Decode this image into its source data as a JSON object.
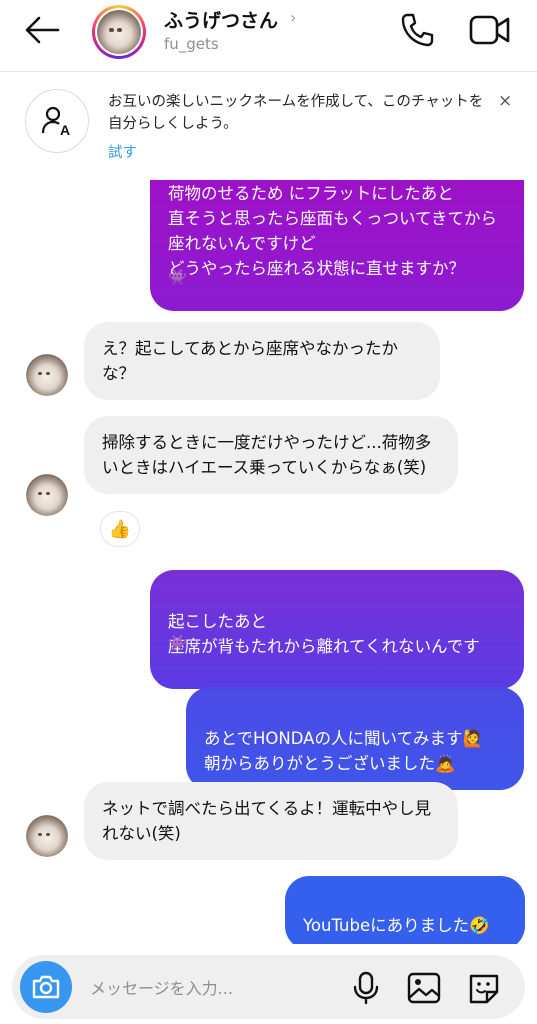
{
  "header": {
    "name": "ふうげつさん",
    "chevron": "›",
    "username": "fu_gets"
  },
  "banner": {
    "text": "お互いの楽しいニックネームを作成して、このチャットを自分らしくしよう。",
    "try_label": "試す",
    "close_label": "×"
  },
  "messages": [
    {
      "from": "me",
      "text": "荷物のせるため にフラットにしたあと\n直そうと思ったら座面もくっついてきてから座れないんですけど\nどうやったら座れる状態に直せますか？"
    },
    {
      "from": "them",
      "text": "え？起こしてあとから座席やなかったかな？"
    },
    {
      "from": "them",
      "text": "掃除するときに一度だけやったけど...荷物多いときはハイエース乗っていくからなぁ(笑)",
      "reaction": "👍"
    },
    {
      "from": "me",
      "text": "起こしたあと\n座席が背もたれから離れてくれないんです"
    },
    {
      "from": "me",
      "text": "あとでHONDAの人に聞いてみます🙋\n朝からありがとうございました🙇"
    },
    {
      "from": "them",
      "text": "ネットで調べたら出てくるよ！運転中やし見れない(笑)"
    },
    {
      "from": "me",
      "text": "YouTubeにありました🤣"
    }
  ],
  "input": {
    "placeholder": "メッセージを入力..."
  },
  "icons": {
    "back": "arrow-left-icon",
    "phone": "phone-icon",
    "video": "video-camera-icon",
    "nickname": "person-tag-icon",
    "camera": "camera-icon",
    "mic": "microphone-icon",
    "gallery": "image-icon",
    "sticker": "sticker-icon"
  },
  "colors": {
    "accent": "#3797f0",
    "bubble_purple": "#9b14c8",
    "bubble_violet": "#6a3ee0",
    "bubble_blue": "#3a5ef0",
    "bubble_in": "#efefef"
  }
}
